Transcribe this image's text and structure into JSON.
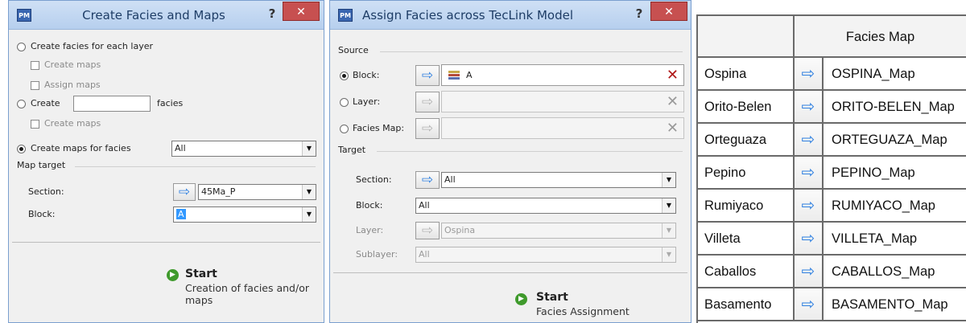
{
  "dialog1": {
    "title": "Create Facies and Maps",
    "app_icon": "PM",
    "help_label": "?",
    "close_label": "✕",
    "opt_each_layer": "Create facies for each layer",
    "create_maps_1": "Create maps",
    "assign_maps": "Assign maps",
    "opt_create": "Create",
    "create_count_value": "",
    "facies_suffix": "facies",
    "create_maps_2": "Create maps",
    "opt_maps_for_facies": "Create maps for facies",
    "maps_for_facies_value": "All",
    "map_target_header": "Map target",
    "section_label": "Section:",
    "section_value": "45Ma_P",
    "block_label": "Block:",
    "block_value": "A",
    "start_title": "Start",
    "start_desc_line1": "Creation of facies and/or",
    "start_desc_line2": "maps"
  },
  "dialog2": {
    "title": "Assign Facies across TecLink Model",
    "app_icon": "PM",
    "help_label": "?",
    "close_label": "✕",
    "source_header": "Source",
    "block_label": "Block:",
    "block_value": "A",
    "layer_label": "Layer:",
    "layer_value": "",
    "facies_map_label": "Facies Map:",
    "facies_map_value": "",
    "target_header": "Target",
    "t_section_label": "Section:",
    "t_section_value": "All",
    "t_block_label": "Block:",
    "t_block_value": "All",
    "t_layer_label": "Layer:",
    "t_layer_value": "Ospina",
    "t_sublayer_label": "Sublayer:",
    "t_sublayer_value": "All",
    "start_title": "Start",
    "start_desc": "Facies Assignment"
  },
  "facies_table": {
    "header": "Facies Map",
    "rows": [
      {
        "name": "Ospina",
        "map": "OSPINA_Map"
      },
      {
        "name": "Orito-Belen",
        "map": "ORITO-BELEN_Map"
      },
      {
        "name": "Orteguaza",
        "map": "ORTEGUAZA_Map"
      },
      {
        "name": "Pepino",
        "map": "PEPINO_Map"
      },
      {
        "name": "Rumiyaco",
        "map": "RUMIYACO_Map"
      },
      {
        "name": "Villeta",
        "map": "VILLETA_Map"
      },
      {
        "name": "Caballos",
        "map": "CABALLOS_Map"
      },
      {
        "name": "Basamento",
        "map": "BASAMENTO_Map"
      }
    ]
  },
  "icons": {
    "arrow": "right-arrow-icon",
    "start": "green-play-icon",
    "clear": "red-x-icon",
    "block": "layers-icon"
  },
  "colors": {
    "accent_blue": "#2e7fe0",
    "close_red": "#c75050",
    "start_green": "#3f9a2c",
    "selection_blue": "#3399ff"
  }
}
